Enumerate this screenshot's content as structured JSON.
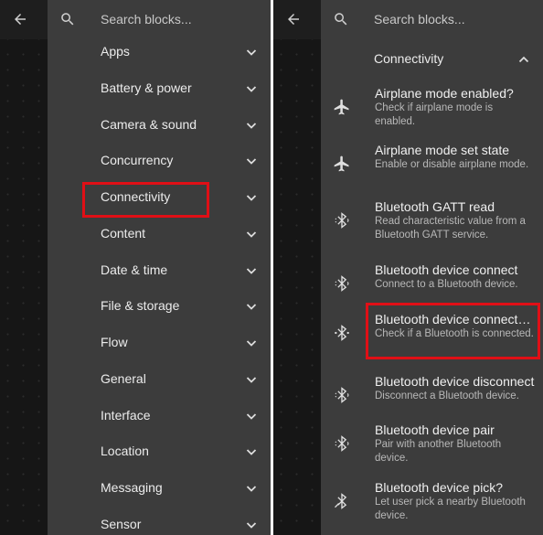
{
  "left_panel": {
    "search_placeholder": "Search blocks...",
    "categories": [
      {
        "label": "Apps"
      },
      {
        "label": "Battery & power"
      },
      {
        "label": "Camera & sound"
      },
      {
        "label": "Concurrency"
      },
      {
        "label": "Connectivity"
      },
      {
        "label": "Content"
      },
      {
        "label": "Date & time"
      },
      {
        "label": "File & storage"
      },
      {
        "label": "Flow"
      },
      {
        "label": "General"
      },
      {
        "label": "Interface"
      },
      {
        "label": "Location"
      },
      {
        "label": "Messaging"
      },
      {
        "label": "Sensor"
      }
    ]
  },
  "right_panel": {
    "search_placeholder": "Search blocks...",
    "section_label": "Connectivity",
    "blocks": [
      {
        "icon": "airplane-icon",
        "title": "Airplane mode enabled?",
        "desc": "Check if airplane mode is enabled."
      },
      {
        "icon": "airplane-icon",
        "title": "Airplane mode set state",
        "desc": "Enable or disable airplane mode."
      },
      {
        "icon": "bluetooth-icon",
        "title": "Bluetooth GATT read",
        "desc": "Read characteristic value from a Bluetooth GATT service."
      },
      {
        "icon": "bluetooth-icon",
        "title": "Bluetooth device connect",
        "desc": "Connect to a Bluetooth device."
      },
      {
        "icon": "bluetooth-connected-icon",
        "title": "Bluetooth device connected?",
        "desc": "Check if a Bluetooth is connected."
      },
      {
        "icon": "bluetooth-icon",
        "title": "Bluetooth device disconnect",
        "desc": "Disconnect a Bluetooth device."
      },
      {
        "icon": "bluetooth-icon",
        "title": "Bluetooth device pair",
        "desc": "Pair with another Bluetooth device."
      },
      {
        "icon": "bluetooth-pick-icon",
        "title": "Bluetooth device pick?",
        "desc": "Let user pick a nearby Bluetooth device."
      }
    ]
  },
  "colors": {
    "drawer_bg": "#3c3c3c",
    "canvas_bg": "#161616",
    "highlight": "#e00f16"
  }
}
